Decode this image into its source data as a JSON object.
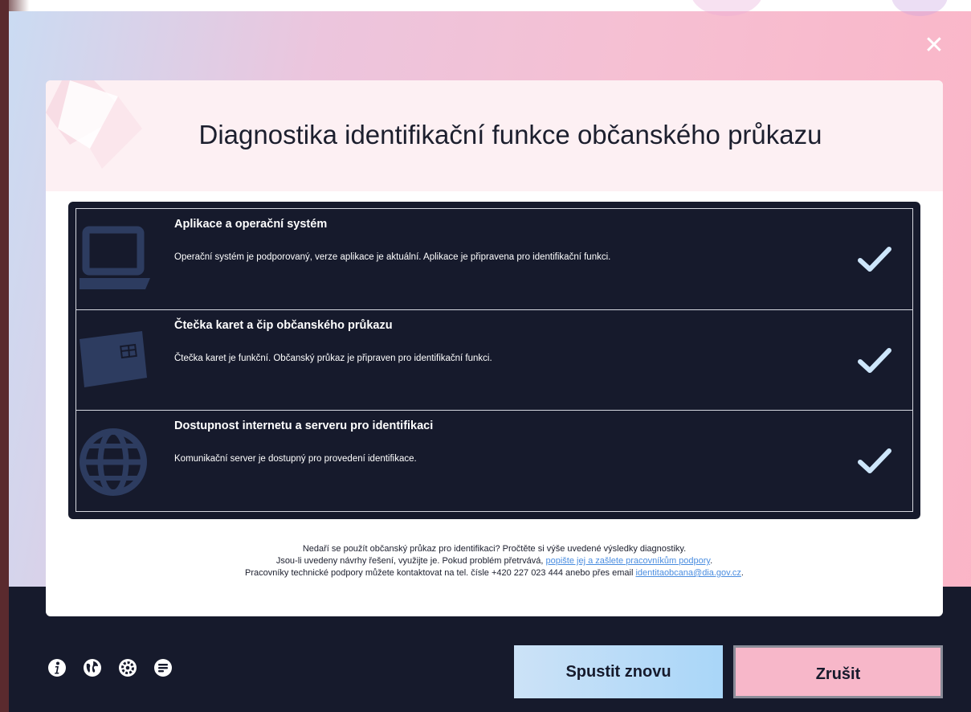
{
  "window": {
    "close_icon": "close-icon"
  },
  "dialog": {
    "title": "Diagnostika identifikační funkce občanského průkazu"
  },
  "checks": [
    {
      "icon": "laptop-icon",
      "title": "Aplikace a operační systém",
      "description": "Operační systém je podporovaný, verze aplikace je aktuální. Aplikace je připravena pro identifikační funkci.",
      "status_icon": "checkmark-icon"
    },
    {
      "icon": "id-card-icon",
      "title": "Čtečka karet a čip občanského průkazu",
      "description": "Čtečka karet je funkční. Občanský průkaz je připraven pro identifikační funkci.",
      "status_icon": "checkmark-icon"
    },
    {
      "icon": "globe-icon",
      "title": "Dostupnost internetu a serveru pro identifikaci",
      "description": "Komunikační server je dostupný pro provedení identifikace.",
      "status_icon": "checkmark-icon"
    }
  ],
  "help": {
    "line1": "Nedaří se použít občanský průkaz pro identifikaci? Pročtěte si výše uvedené výsledky diagnostiky.",
    "line2_prefix": "Jsou-li uvedeny návrhy řešení, využijte je. Pokud problém přetrvává, ",
    "line2_link": "popište jej a zašlete pracovníkům podpory",
    "line2_suffix": ".",
    "line3_prefix": "Pracovníky technické podpory můžete kontaktovat na tel. čísle +420 227 023 444 anebo přes email ",
    "line3_link": "identitaobcana@dia.gov.cz",
    "line3_suffix": "."
  },
  "toolbar": {
    "icons": [
      "info-icon",
      "globe-icon",
      "settings-icon",
      "feedback-icon"
    ]
  },
  "buttons": {
    "restart_label": "Spustit znovu",
    "cancel_label": "Zrušit"
  },
  "colors": {
    "dark_navy": "#161a2c",
    "check_blue": "#cde6fb",
    "link_blue": "#4a8de0",
    "cancel_pink": "#f7b7c9",
    "restart_blue": "#a9d6f8"
  }
}
